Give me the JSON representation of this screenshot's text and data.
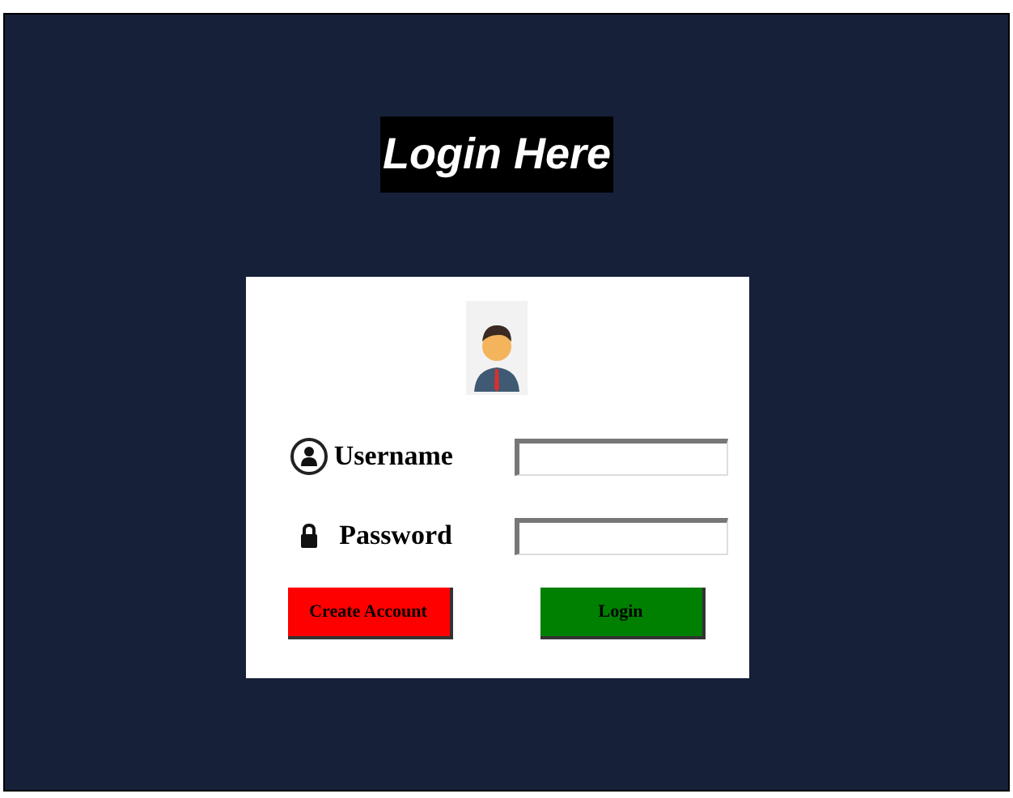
{
  "heading": "Login Here",
  "form": {
    "fields": [
      {
        "kind": "user",
        "label": "Username"
      },
      {
        "kind": "lock",
        "label": "Password"
      }
    ],
    "buttons": [
      {
        "kind": "danger",
        "label": "Create Account"
      },
      {
        "kind": "success",
        "label": "Login"
      }
    ]
  }
}
